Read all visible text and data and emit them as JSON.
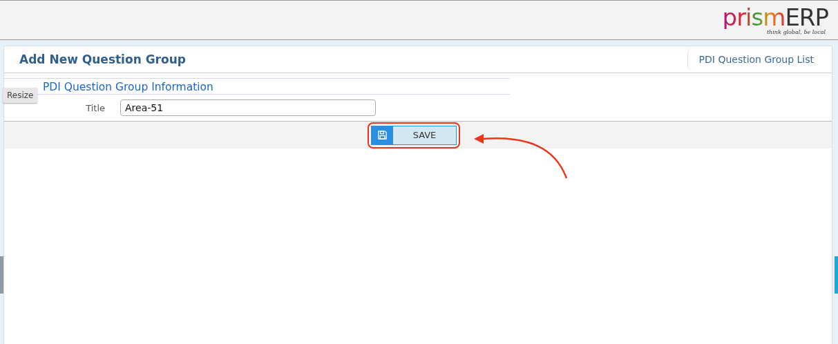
{
  "logo": {
    "brand_prefix": "prism",
    "brand_suffix": "ERP",
    "tagline": "think global, be local"
  },
  "page": {
    "title": "Add New Question Group",
    "link": "PDI Question Group List"
  },
  "section": {
    "title": "PDI Question Group Information"
  },
  "resize_tag": "Resize",
  "form": {
    "fields": [
      {
        "label": "Title",
        "value": "Area-51"
      }
    ]
  },
  "save_button": {
    "label": "SAVE",
    "highlighted": true
  }
}
